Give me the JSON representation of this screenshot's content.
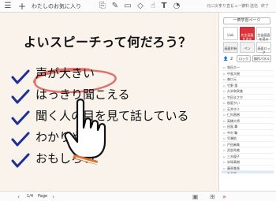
{
  "toolbar": {
    "title": "わたしのお気に入り",
    "menu_icon": "menu-icon",
    "add_icon": "plus-icon",
    "tools": [
      "share-icon",
      "pen-icon",
      "marker-icon",
      "eraser-icon",
      "pointer-icon",
      "text-icon",
      "shapes-icon"
    ],
    "right_labels": [
      "元に戻す",
      "やり直し",
      "ビューア",
      "資料",
      "送信",
      "終了"
    ]
  },
  "slide": {
    "title": "よいスピーチって何だろう？",
    "items": [
      "声が大きい",
      "はっきり聞こえる",
      "聞く人の目を見て話している",
      "わかりやすい",
      "おもしろい"
    ]
  },
  "bottom": {
    "page_indicator": "1/4",
    "page_label": "Page",
    "prev_icon": "chevron-left-icon",
    "next_icon": "chevron-right-icon"
  },
  "panel": {
    "home_label": "一斉学習ページ",
    "tiles": [
      "Link",
      "先生画面を送る",
      "生徒画面を見る",
      "画面共有",
      "ペン",
      "画面ロック"
    ],
    "buttons": [
      "ロック",
      "操作パネル"
    ],
    "count": "2",
    "roster": [
      "和田大一",
      "中島大樹",
      "森口元",
      "竹野 惠",
      "久米和泉美",
      "竹田まさか",
      "桜庭かい",
      "石井ゆう",
      "仁科直樹",
      "高橋大将",
      "田島 翼",
      "中村 鞠",
      "早瀬航",
      "戸田麻美",
      "武部秀美",
      "三木優子",
      "米塚真樹",
      "藤原美香",
      "金乃勝"
    ],
    "highlighted_index": 18
  },
  "colors": {
    "accent": "#d9343a",
    "check": "#1e2f9a",
    "circle": "#e0726d",
    "slide_bg": "#f9f3ec"
  }
}
